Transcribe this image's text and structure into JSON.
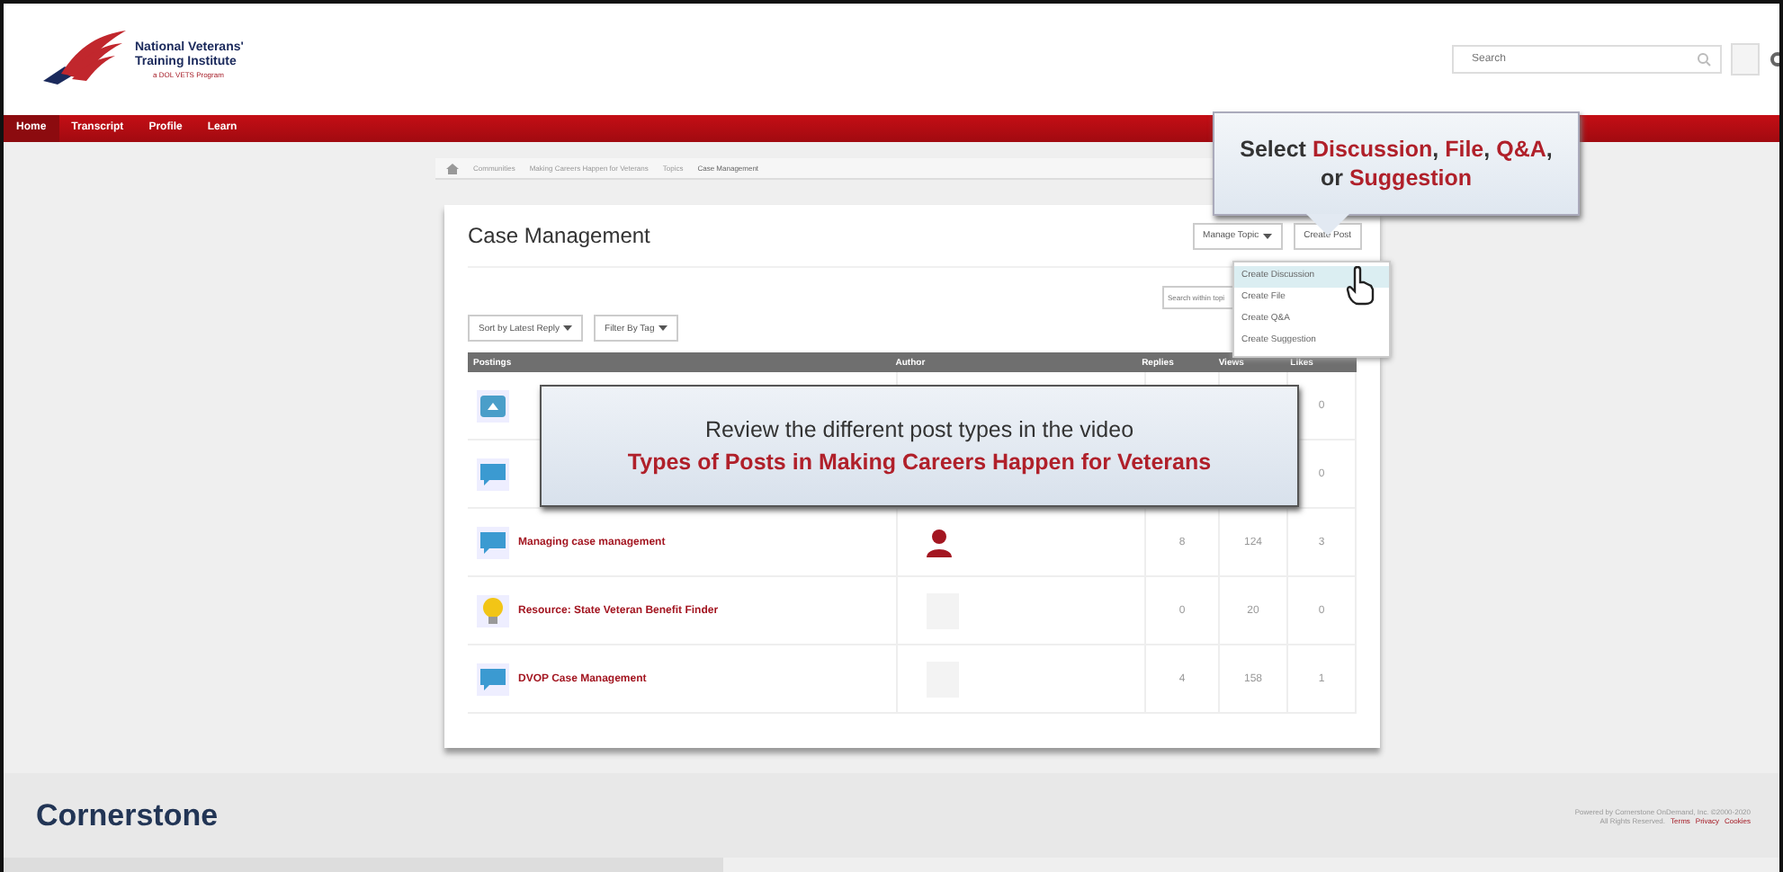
{
  "header": {
    "logo": {
      "line_1": "National Veterans'",
      "line_2": "Training Institute",
      "line_3": "a DOL VETS Program"
    },
    "search": {
      "placeholder": "Search"
    }
  },
  "nav": [
    {
      "label": "Home",
      "selected": true
    },
    {
      "label": "Transcript",
      "selected": false
    },
    {
      "label": "Profile",
      "selected": false
    },
    {
      "label": "Learn",
      "selected": false
    }
  ],
  "breadcrumb": [
    "Communities",
    "Making Careers Happen for Veterans",
    "Topics",
    "Case Management"
  ],
  "card": {
    "title": "Case Management",
    "manage_button": "Manage Topic",
    "create_button": "Create Post",
    "search": {
      "placeholder": "Search within topi"
    },
    "sort_button": "Sort by Latest Reply",
    "filter_button": "Filter By Tag"
  },
  "table": {
    "columns": [
      "Postings",
      "Author",
      "Replies",
      "Views",
      "Likes"
    ],
    "rows": [
      {
        "kind": "file",
        "likes": "0"
      },
      {
        "kind": "discussion",
        "likes": "0"
      },
      {
        "kind": "discussion",
        "title": "Managing case management",
        "author": {
          "kind": "icon"
        },
        "replies": "8",
        "views": "124",
        "likes": "3"
      },
      {
        "kind": "suggestion",
        "title": "Resource: State Veteran Benefit Finder",
        "author": {
          "kind": "photo"
        },
        "replies": "0",
        "views": "20",
        "likes": "0"
      },
      {
        "kind": "discussion",
        "title": "DVOP Case Management",
        "author": {
          "kind": "photo"
        },
        "replies": "4",
        "views": "158",
        "likes": "1"
      }
    ]
  },
  "menu": [
    {
      "label": "Create Discussion",
      "selected": true
    },
    {
      "label": "Create File",
      "selected": false
    },
    {
      "label": "Create Q&A",
      "selected": false
    },
    {
      "label": "Create Suggestion",
      "selected": false
    }
  ],
  "callout": {
    "line_1": [
      {
        "text": "Select ",
        "highlight": false
      },
      {
        "text": "Discussion",
        "highlight": true
      },
      {
        "text": ", ",
        "highlight": false
      },
      {
        "text": "File",
        "highlight": true
      },
      {
        "text": ", ",
        "highlight": false
      },
      {
        "text": "Q&A",
        "highlight": true
      },
      {
        "text": ",",
        "highlight": false
      }
    ],
    "line_2": [
      {
        "text": "or ",
        "highlight": false
      },
      {
        "text": "Suggestion",
        "highlight": true
      }
    ]
  },
  "overlay": {
    "line_1": "Review the different post types in the video",
    "line_2": "Types of Posts in Making Careers Happen for Veterans"
  },
  "footer": {
    "logo": "Cornerstone",
    "line_1": "Powered by Cornerstone OnDemand, Inc. ©2000-2020",
    "line_2": "All Rights Reserved.",
    "links": [
      "Terms",
      "Privacy",
      "Cookies"
    ]
  }
}
